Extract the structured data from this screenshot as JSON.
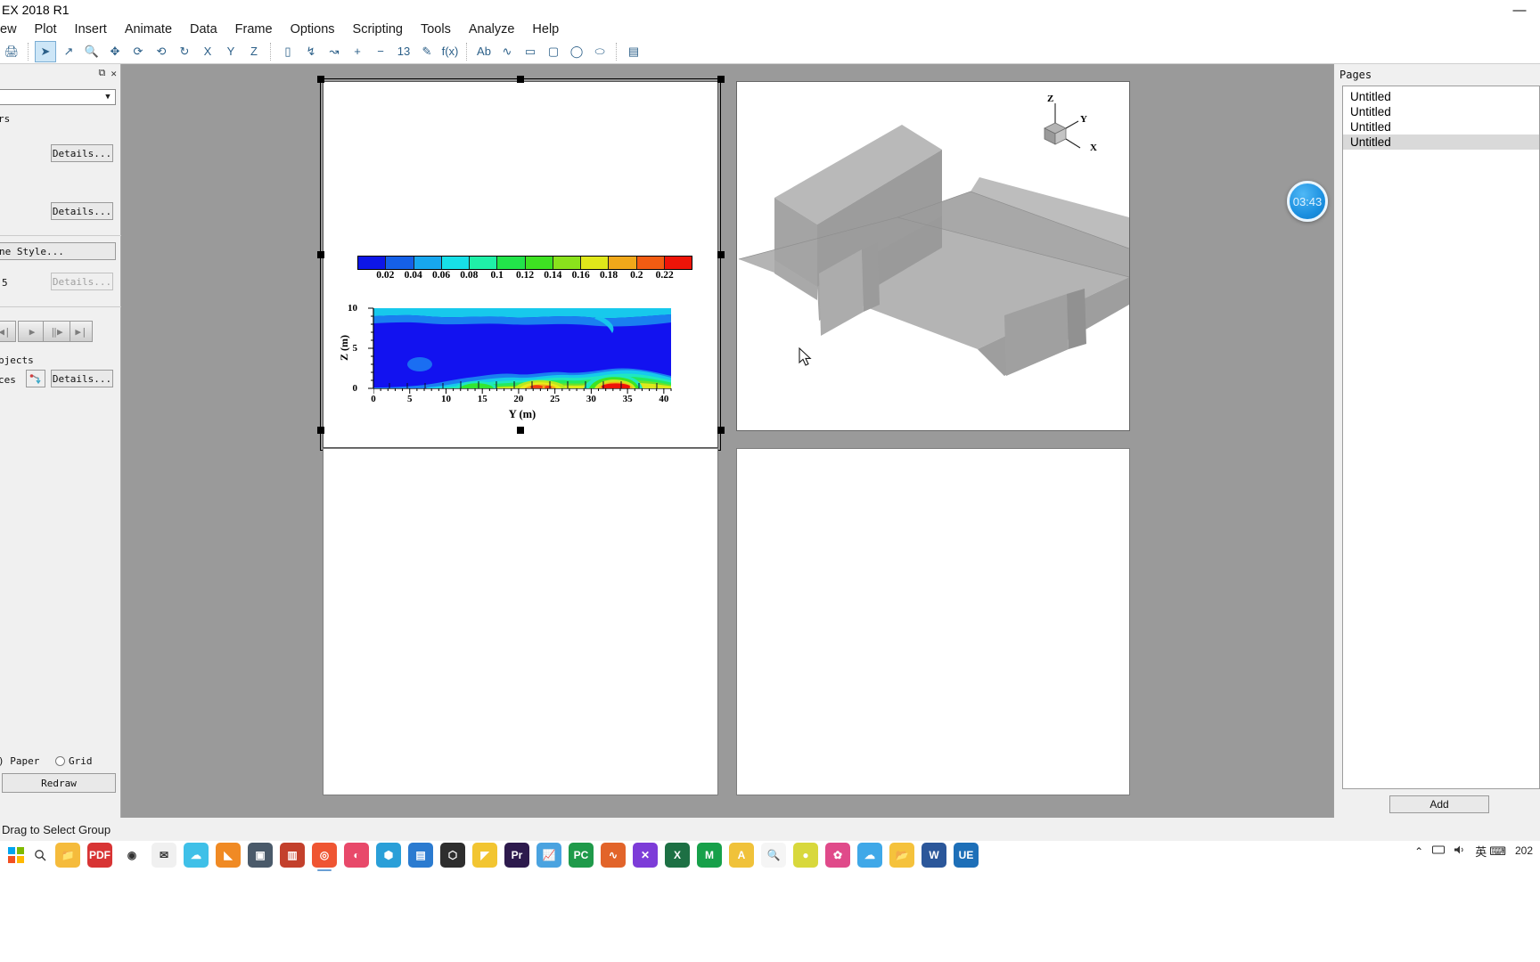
{
  "window": {
    "title": "EX 2018 R1",
    "minimize_label": "—"
  },
  "menu": {
    "items": [
      "ew",
      "Plot",
      "Insert",
      "Animate",
      "Data",
      "Frame",
      "Options",
      "Scripting",
      "Tools",
      "Analyze",
      "Help"
    ]
  },
  "toolbar": {
    "groups": [
      {
        "buttons": [
          {
            "name": "print-icon",
            "glyph": "🖨"
          }
        ]
      },
      {
        "buttons": [
          {
            "name": "select-arrow-icon",
            "glyph": "➤",
            "selected": true
          },
          {
            "name": "adjust-arrow-icon",
            "glyph": "↗"
          },
          {
            "name": "zoom-icon",
            "glyph": "🔍"
          },
          {
            "name": "translate-icon",
            "glyph": "✥"
          },
          {
            "name": "rotate-spherical-icon",
            "glyph": "⟳"
          },
          {
            "name": "rotate-roller-icon",
            "glyph": "⟲"
          },
          {
            "name": "rotate-twist-icon",
            "glyph": "↻"
          },
          {
            "name": "rotate-x-icon",
            "glyph": "X"
          },
          {
            "name": "rotate-y-icon",
            "glyph": "Y"
          },
          {
            "name": "rotate-z-icon",
            "glyph": "Z"
          }
        ]
      },
      {
        "buttons": [
          {
            "name": "slice-icon",
            "glyph": "▯"
          },
          {
            "name": "streamtrace-icon",
            "glyph": "↯"
          },
          {
            "name": "streamtrace-add-icon",
            "glyph": "↝"
          },
          {
            "name": "contour-add-level-icon",
            "glyph": "+"
          },
          {
            "name": "contour-remove-level-icon",
            "glyph": "−"
          },
          {
            "name": "probe-icon",
            "glyph": "13"
          },
          {
            "name": "extract-points-icon",
            "glyph": "✎"
          },
          {
            "name": "create-function-icon",
            "glyph": "f(x)"
          }
        ]
      },
      {
        "buttons": [
          {
            "name": "text-tool-icon",
            "glyph": "Ab"
          },
          {
            "name": "polyline-tool-icon",
            "glyph": "∿"
          },
          {
            "name": "rectangle-tool-icon",
            "glyph": "▭"
          },
          {
            "name": "square-tool-icon",
            "glyph": "▢"
          },
          {
            "name": "circle-tool-icon",
            "glyph": "◯"
          },
          {
            "name": "ellipse-tool-icon",
            "glyph": "⬭"
          }
        ]
      },
      {
        "buttons": [
          {
            "name": "image-insert-icon",
            "glyph": "▤"
          }
        ]
      }
    ]
  },
  "sidebar": {
    "float_icon": "⧉",
    "close_icon": "✕",
    "combo_value": "",
    "label_vectors": "rs",
    "details_1": "Details...",
    "details_2": "Details...",
    "zone_style": "ne Style...",
    "level_count": "5",
    "details_3": "Details...",
    "vcr": [
      "⏮",
      "▶",
      "⏭",
      "⏭"
    ],
    "objects_label": "bjects",
    "traces_label": "ces",
    "details_4": "Details...",
    "paper_label": ") Paper",
    "grid_label": "Grid",
    "redraw_label": "Redraw"
  },
  "pages": {
    "title": "Pages",
    "items": [
      {
        "label": "Untitled",
        "selected": false
      },
      {
        "label": "Untitled",
        "selected": false
      },
      {
        "label": "Untitled",
        "selected": false
      },
      {
        "label": "Untitled",
        "selected": true
      }
    ],
    "add_label": "Add"
  },
  "timer": {
    "value": "03:43"
  },
  "statusbar": {
    "text": "Drag to Select Group"
  },
  "frames": {
    "frame1_selected": true,
    "frame2_title": "3d-geometry-view",
    "frame3_title": "empty-frame",
    "frame4_title": "empty-frame"
  },
  "triad": {
    "z_label": "Z",
    "y_label": "Y",
    "x_label": "X"
  },
  "chart_data": {
    "type": "heatmap",
    "title": "",
    "xlabel": "Y (m)",
    "ylabel": "Z (m)",
    "xlim": [
      0,
      41
    ],
    "ylim": [
      0,
      10
    ],
    "xticks": [
      0,
      5,
      10,
      15,
      20,
      25,
      30,
      35,
      40
    ],
    "yticks": [
      0,
      5,
      10
    ],
    "grid": false,
    "legend": "horizontal-colorbar-above-plot",
    "colorbar": {
      "orientation": "horizontal",
      "tick_labels": [
        "0.02",
        "0.04",
        "0.06",
        "0.08",
        "0.1",
        "0.12",
        "0.14",
        "0.16",
        "0.18",
        "0.2",
        "0.22"
      ],
      "tick_values": [
        0.02,
        0.04,
        0.06,
        0.08,
        0.1,
        0.12,
        0.14,
        0.16,
        0.18,
        0.2,
        0.22
      ],
      "vmin": 0.0,
      "vmax": 0.24,
      "colors": [
        "#0d16e8",
        "#1560e8",
        "#17a7ef",
        "#17e0e8",
        "#1ff0a8",
        "#22e44a",
        "#3ee222",
        "#8ae21c",
        "#e0e81a",
        "#f0a81a",
        "#f25c12",
        "#ee1408"
      ]
    },
    "field_note": "Concentration contour: near-zero blue through most of domain, hot band along bottom (Z<2 m) rising toward Y=20-35 m with peak red region near Y=30-33 m",
    "hotspots": [
      {
        "y": 13,
        "z": 1.2,
        "value": 0.09
      },
      {
        "y": 22,
        "z": 1.2,
        "value": 0.17
      },
      {
        "y": 31.5,
        "z": 1.0,
        "value": 0.23
      }
    ]
  },
  "taskbar": {
    "start_icon": "start-icon",
    "search_icon": "search-icon",
    "apps": [
      {
        "name": "file-explorer-yellow",
        "glyph": "📁",
        "color": "#f5bb3c"
      },
      {
        "name": "pdf-reader",
        "glyph": "PDF",
        "color": "#d83434"
      },
      {
        "name": "chrome-browser",
        "glyph": "◉",
        "color": "#ffffff"
      },
      {
        "name": "mail-app",
        "glyph": "✉",
        "color": "#f0f0f0"
      },
      {
        "name": "cloud-app",
        "glyph": "☁",
        "color": "#3fc0e8"
      },
      {
        "name": "sublime-editor",
        "glyph": "◣",
        "color": "#f08a24"
      },
      {
        "name": "terminal-app",
        "glyph": "▣",
        "color": "#4a5a6a"
      },
      {
        "name": "office-suite",
        "glyph": "▥",
        "color": "#c3402c"
      },
      {
        "name": "browser-alt",
        "glyph": "◎",
        "color": "#ef5532",
        "active": true
      },
      {
        "name": "design-app",
        "glyph": "◐",
        "color": "#e8496a"
      },
      {
        "name": "blender-app",
        "glyph": "⬢",
        "color": "#2a9fd8"
      },
      {
        "name": "notes-app",
        "glyph": "▤",
        "color": "#2b7bd0"
      },
      {
        "name": "shell-app",
        "glyph": "⬡",
        "color": "#2e2e2e"
      },
      {
        "name": "autocad-app",
        "glyph": "◤",
        "color": "#f2c531"
      },
      {
        "name": "premiere-app",
        "glyph": "Pr",
        "color": "#2d1a4d"
      },
      {
        "name": "chart-app",
        "glyph": "📈",
        "color": "#4aa3e0"
      },
      {
        "name": "pycharm-app",
        "glyph": "PC",
        "color": "#1f9a4a"
      },
      {
        "name": "matlab-app",
        "glyph": "∿",
        "color": "#e2642a"
      },
      {
        "name": "editor-x",
        "glyph": "✕",
        "color": "#7d3cd8"
      },
      {
        "name": "excel-app",
        "glyph": "X",
        "color": "#1d7044"
      },
      {
        "name": "mathtype-app",
        "glyph": "M",
        "color": "#17a04a"
      },
      {
        "name": "ansys-app",
        "glyph": "A",
        "color": "#f0c23a"
      },
      {
        "name": "search-tool",
        "glyph": "🔍",
        "color": "#f5f5f5"
      },
      {
        "name": "color-app",
        "glyph": "●",
        "color": "#d8d83c"
      },
      {
        "name": "photo-app",
        "glyph": "✿",
        "color": "#e04a8a"
      },
      {
        "name": "cloud-sync",
        "glyph": "☁",
        "color": "#3fa8e8"
      },
      {
        "name": "folder-explorer",
        "glyph": "📂",
        "color": "#f5c23c"
      },
      {
        "name": "word-app",
        "glyph": "W",
        "color": "#2b579a"
      },
      {
        "name": "ue-editor",
        "glyph": "UE",
        "color": "#1d6fb8"
      }
    ],
    "tray": {
      "chevron": "⌃",
      "network_icon": "▭",
      "volume_icon": "🔊",
      "ime_text": "英",
      "ime_icon": "⌨",
      "clock_line1": "202"
    }
  }
}
